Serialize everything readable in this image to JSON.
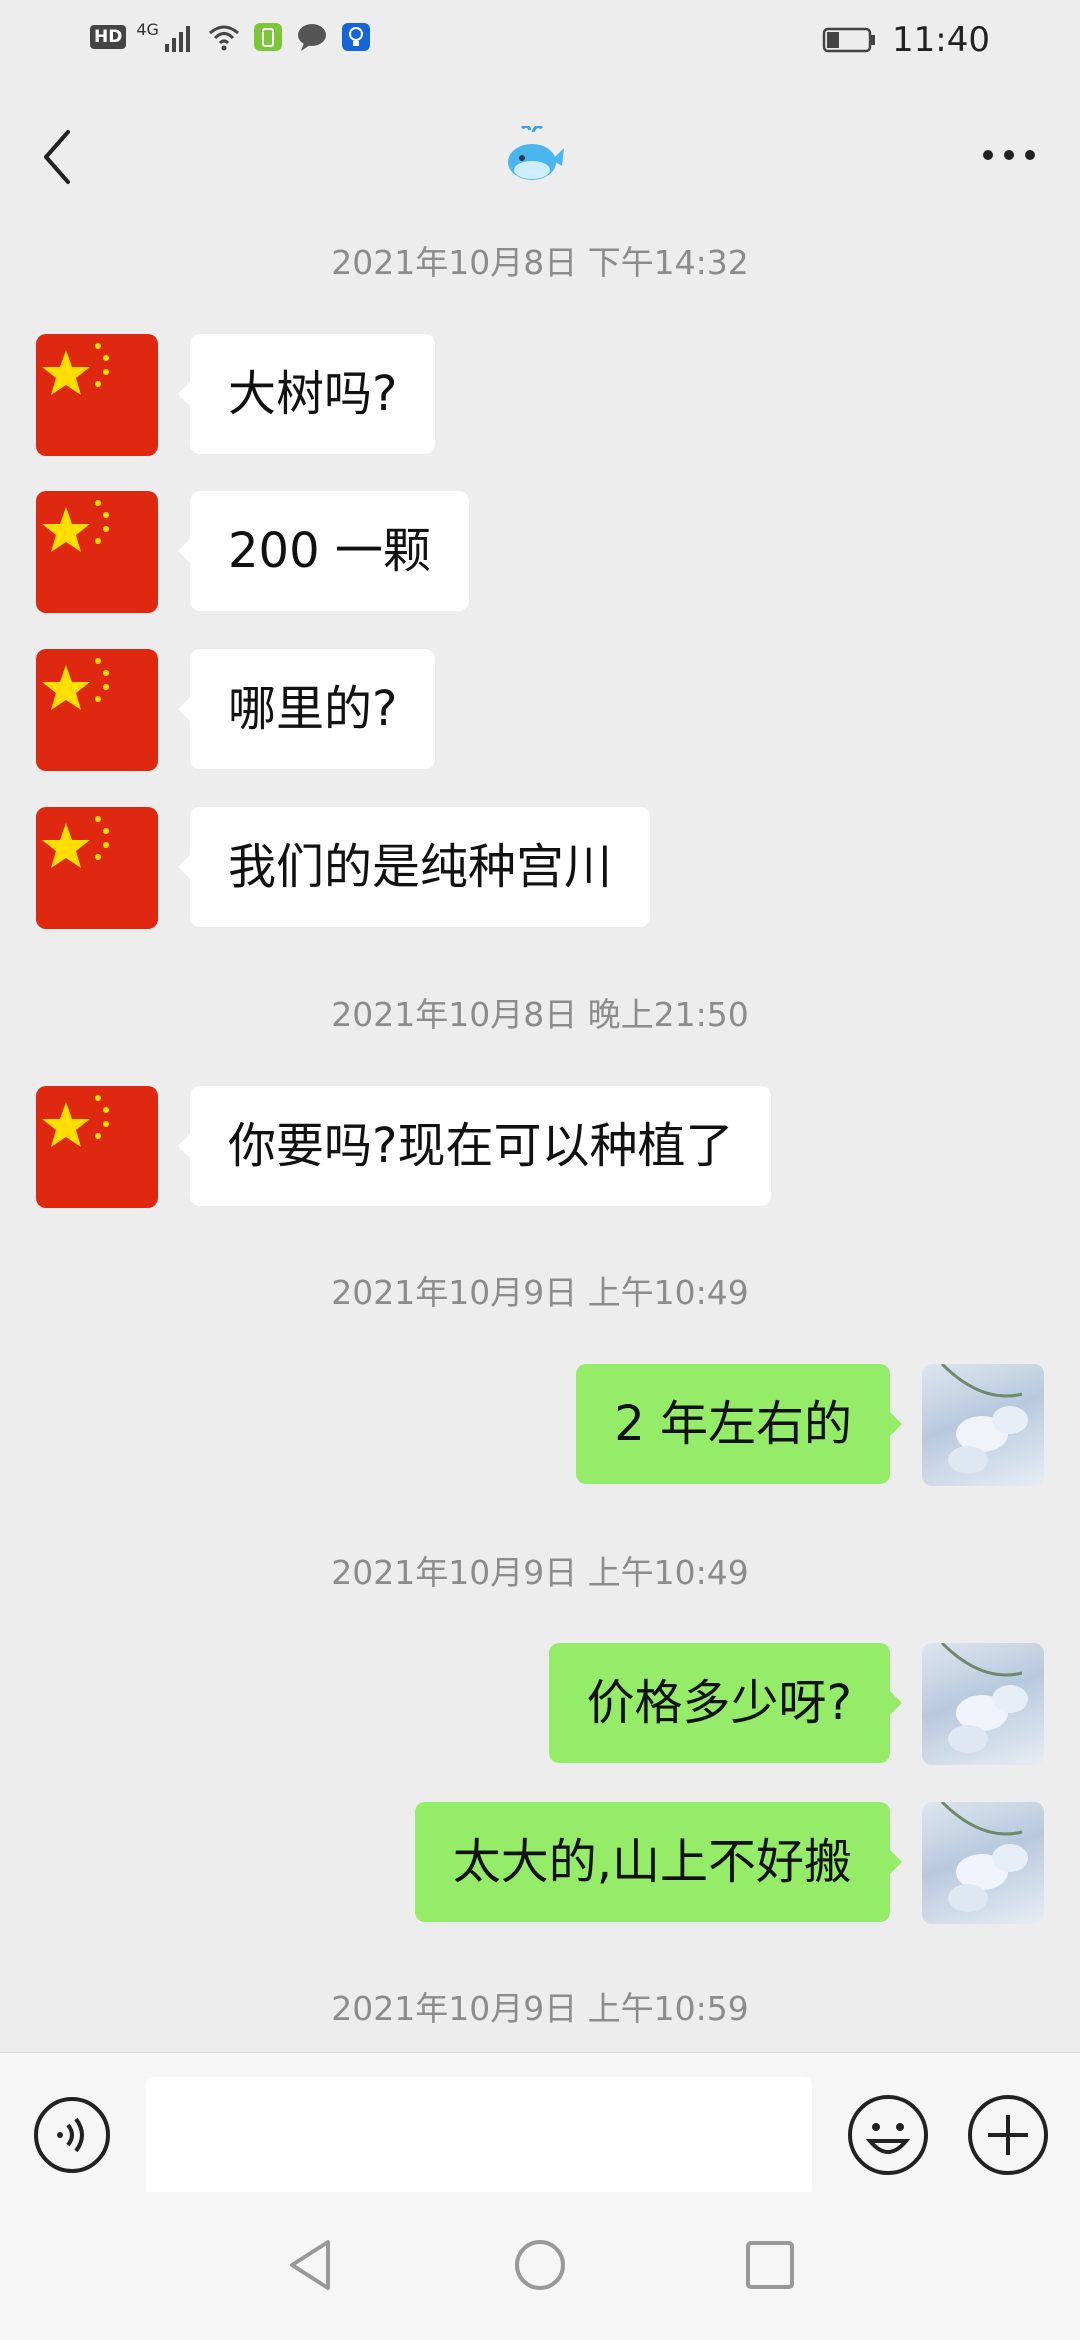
{
  "status_bar": {
    "hd_label": "HD",
    "network_label": "4G",
    "time": "11:40",
    "icons": [
      "hd-icon",
      "signal-icon",
      "wifi-icon",
      "battery-app-icon",
      "message-bubble-icon",
      "lightbulb-app-icon",
      "battery-icon"
    ]
  },
  "header": {
    "title_icon": "whale-icon",
    "back_icon": "chevron-left-icon",
    "more_icon": "more-dots-icon"
  },
  "messages": [
    {
      "type": "timestamp",
      "text": "2021年10月8日 下午14:32"
    },
    {
      "type": "msg",
      "side": "left",
      "avatar": "china-flag-avatar",
      "text": "大树吗?"
    },
    {
      "type": "msg",
      "side": "left",
      "avatar": "china-flag-avatar",
      "text": "200 一颗"
    },
    {
      "type": "msg",
      "side": "left",
      "avatar": "china-flag-avatar",
      "text": "哪里的?"
    },
    {
      "type": "msg",
      "side": "left",
      "avatar": "china-flag-avatar",
      "text": "我们的是纯种宫川"
    },
    {
      "type": "timestamp",
      "text": "2021年10月8日 晚上21:50"
    },
    {
      "type": "msg",
      "side": "left",
      "avatar": "china-flag-avatar",
      "text": "你要吗?现在可以种植了"
    },
    {
      "type": "timestamp",
      "text": "2021年10月9日 上午10:49"
    },
    {
      "type": "msg",
      "side": "right",
      "avatar": "flower-photo-avatar",
      "text": "2 年左右的"
    },
    {
      "type": "timestamp",
      "text": "2021年10月9日 上午10:49"
    },
    {
      "type": "msg",
      "side": "right",
      "avatar": "flower-photo-avatar",
      "text": "价格多少呀?"
    },
    {
      "type": "msg",
      "side": "right",
      "avatar": "flower-photo-avatar",
      "text": "太大的,山上不好搬"
    },
    {
      "type": "timestamp",
      "text": "2021年10月9日 上午10:59"
    }
  ],
  "input_bar": {
    "voice_icon": "voice-icon",
    "input_value": "",
    "emoji_icon": "emoji-icon",
    "plus_icon": "plus-icon"
  },
  "nav_bar": {
    "back_icon": "nav-back-icon",
    "home_icon": "nav-home-icon",
    "recent_icon": "nav-recent-icon"
  },
  "colors": {
    "background": "#ededed",
    "bubble_left": "#ffffff",
    "bubble_right": "#95ec69",
    "timestamp": "#8c8c8c",
    "flag_red": "#de2910",
    "flag_yellow": "#ffde00"
  }
}
